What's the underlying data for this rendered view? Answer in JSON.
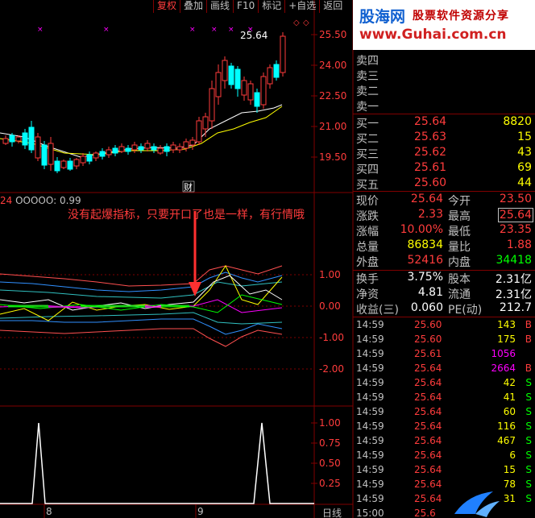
{
  "toolbar": [
    "复权",
    "叠加",
    "画线",
    "F10",
    "标记",
    "+自选",
    "返回"
  ],
  "logo": {
    "name": "股海网",
    "slogan": "股票软件资源分享",
    "url": "www.Guhai.com.cn"
  },
  "price_axis": [
    "25.50",
    "24.00",
    "22.50",
    "21.00",
    "19.50"
  ],
  "peak_label": "25.64",
  "news_marker": "财",
  "indicator_label": "OOOOO: 0.99",
  "annotation": "没有起爆指标，只要开口了也是一样，有行情哦",
  "osc_axis": [
    "1.00",
    "0.00",
    "-1.00",
    "-2.00"
  ],
  "bottom_axis": [
    "1.00",
    "0.75",
    "0.50",
    "0.25"
  ],
  "date_labels": [
    "8",
    "9"
  ],
  "period": "日线",
  "sell_orders": [
    {
      "label": "卖四"
    },
    {
      "label": "卖三"
    },
    {
      "label": "卖二"
    },
    {
      "label": "卖一"
    }
  ],
  "buy_orders": [
    {
      "label": "买一",
      "price": "25.64",
      "vol": "8820"
    },
    {
      "label": "买二",
      "price": "25.63",
      "vol": "15"
    },
    {
      "label": "买三",
      "price": "25.62",
      "vol": "43"
    },
    {
      "label": "买四",
      "price": "25.61",
      "vol": "69"
    },
    {
      "label": "买五",
      "price": "25.60",
      "vol": "44"
    }
  ],
  "quote": [
    {
      "l1": "现价",
      "v1": "25.64",
      "l2": "今开",
      "v2": "23.50"
    },
    {
      "l1": "涨跌",
      "v1": "2.33",
      "l2": "最高",
      "v2": "25.64"
    },
    {
      "l1": "涨幅",
      "v1": "10.00%",
      "l2": "最低",
      "v2": "23.35"
    },
    {
      "l1": "总量",
      "v1": "86834",
      "l2": "量比",
      "v2": "1.88"
    },
    {
      "l1": "外盘",
      "v1": "52416",
      "l2": "内盘",
      "v2": "34418"
    }
  ],
  "fundamentals": [
    {
      "l1": "换手",
      "v1": "3.75%",
      "l2": "股本",
      "v2": "2.31亿"
    },
    {
      "l1": "净资",
      "v1": "4.81",
      "l2": "流通",
      "v2": "2.31亿"
    },
    {
      "l1": "收益(三)",
      "v1": "0.060",
      "l2": "PE(动)",
      "v2": "212.7"
    }
  ],
  "ticks": [
    {
      "time": "14:59",
      "price": "25.60",
      "vol": "143",
      "side": "B",
      "color": "#ffff00"
    },
    {
      "time": "14:59",
      "price": "25.60",
      "vol": "175",
      "side": "B",
      "color": "#ffff00"
    },
    {
      "time": "14:59",
      "price": "25.61",
      "vol": "1056",
      "side": "",
      "color": "#ff00ff"
    },
    {
      "time": "14:59",
      "price": "25.64",
      "vol": "2664",
      "side": "B",
      "color": "#ff00ff"
    },
    {
      "time": "14:59",
      "price": "25.64",
      "vol": "42",
      "side": "S",
      "color": "#ffff00"
    },
    {
      "time": "14:59",
      "price": "25.64",
      "vol": "41",
      "side": "S",
      "color": "#ffff00"
    },
    {
      "time": "14:59",
      "price": "25.64",
      "vol": "60",
      "side": "S",
      "color": "#ffff00"
    },
    {
      "time": "14:59",
      "price": "25.64",
      "vol": "116",
      "side": "S",
      "color": "#ffff00"
    },
    {
      "time": "14:59",
      "price": "25.64",
      "vol": "467",
      "side": "S",
      "color": "#ffff00"
    },
    {
      "time": "14:59",
      "price": "25.64",
      "vol": "6",
      "side": "S",
      "color": "#ffff00"
    },
    {
      "time": "14:59",
      "price": "25.64",
      "vol": "15",
      "side": "S",
      "color": "#ffff00"
    },
    {
      "time": "14:59",
      "price": "25.64",
      "vol": "78",
      "side": "S",
      "color": "#ffff00"
    },
    {
      "time": "14:59",
      "price": "25.64",
      "vol": "31",
      "side": "S",
      "color": "#ffff00"
    },
    {
      "time": "15:00",
      "price": "25.6",
      "vol": "",
      "side": "",
      "color": "#ffff00"
    }
  ]
}
